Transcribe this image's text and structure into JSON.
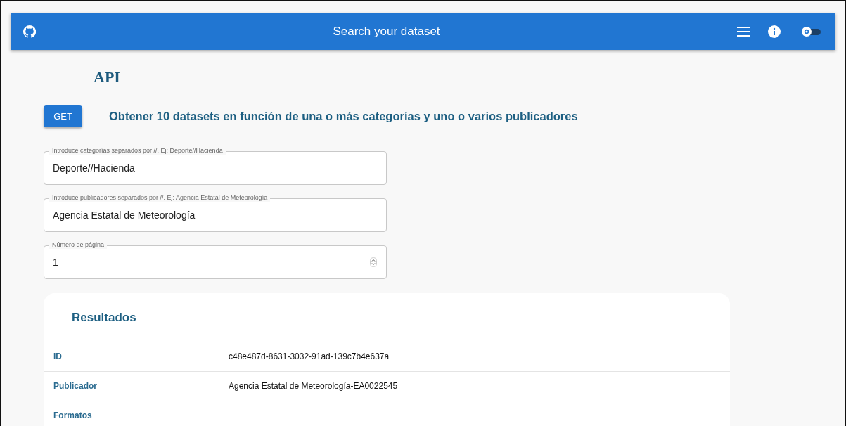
{
  "navbar": {
    "title": "Search your dataset",
    "theme_toggle": {
      "on": false
    }
  },
  "page_title": "API",
  "endpoint": {
    "method": "GET",
    "description": "Obtener 10 datasets en función de una o más categorías y uno o varios publicadores"
  },
  "fields": [
    {
      "kind": "text",
      "label": "Introduce categorías separados por //. Ej: Deporte//Hacienda",
      "value": "Deporte//Hacienda"
    },
    {
      "kind": "text",
      "label": "Introduce publicadores separados por //. Ej: Agencia Estatal de Meteorología",
      "value": "Agencia Estatal de Meteorología"
    },
    {
      "kind": "number",
      "label": "Número de página",
      "value": "1"
    }
  ],
  "results": {
    "title": "Resultados",
    "rows": [
      {
        "key": "ID",
        "value": "c48e487d-8631-3032-91ad-139c7b4e637a"
      },
      {
        "key": "Publicador",
        "value": "Agencia Estatal de Meteorología-EA0022545"
      },
      {
        "key": "Formatos"
      }
    ]
  }
}
